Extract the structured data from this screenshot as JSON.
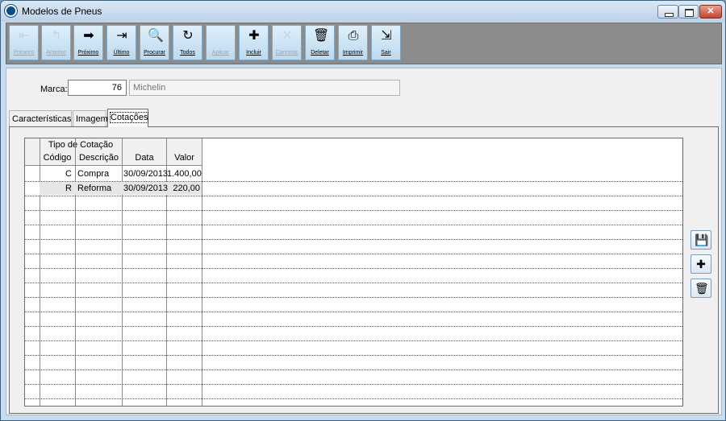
{
  "window": {
    "title": "Modelos de Pneus",
    "close_glyph": "✕"
  },
  "toolbar": {
    "buttons": [
      {
        "label": "Primeiro",
        "icon": "first-record-icon",
        "glyph": "⇤",
        "enabled": false
      },
      {
        "label": "Anterior",
        "icon": "previous-record-icon",
        "glyph": "↰",
        "enabled": false
      },
      {
        "label": "Próximo",
        "icon": "next-record-icon",
        "glyph": "➡",
        "enabled": true
      },
      {
        "label": "Último",
        "icon": "last-record-icon",
        "glyph": "⇥",
        "enabled": true
      },
      {
        "label": "Procurar",
        "icon": "search-icon",
        "glyph": "🔍",
        "enabled": true
      },
      {
        "label": "Todos",
        "icon": "refresh-all-icon",
        "glyph": "↻",
        "enabled": true
      },
      {
        "label": "Aplicar",
        "icon": "apply-icon",
        "glyph": "",
        "enabled": false
      },
      {
        "label": "Incluir",
        "icon": "new-record-icon",
        "glyph": "✚",
        "enabled": true
      },
      {
        "label": "Cancelar",
        "icon": "cancel-icon",
        "glyph": "✕",
        "enabled": false
      },
      {
        "label": "Deletar",
        "icon": "trash-icon",
        "glyph": "🗑",
        "enabled": true
      },
      {
        "label": "Imprimir",
        "icon": "printer-icon",
        "glyph": "⎙",
        "enabled": true
      },
      {
        "label": "Sair",
        "icon": "exit-icon",
        "glyph": "⇲",
        "enabled": true
      }
    ]
  },
  "marca": {
    "label": "Marca:",
    "code": "76",
    "name": "Michelin"
  },
  "tabs": [
    "Características",
    "Imagem",
    "Cotações"
  ],
  "grid": {
    "group_header": "Tipo de Cotação",
    "columns": [
      "Código",
      "Descrição",
      "Data",
      "Valor"
    ],
    "rows": [
      {
        "codigo": "C",
        "descricao": "Compra",
        "data": "30/09/2013",
        "valor": "1.400,00"
      },
      {
        "codigo": "R",
        "descricao": "Reforma",
        "data": "30/09/2013",
        "valor": "220,00"
      }
    ]
  },
  "side_buttons": [
    {
      "icon": "save-icon",
      "glyph": "💾"
    },
    {
      "icon": "new-record-icon",
      "glyph": "✚"
    },
    {
      "icon": "trash-icon",
      "glyph": "🗑"
    }
  ],
  "colors": {
    "toolbar_bg": "#8c8c8c",
    "accent": "#0a4b8a",
    "close_button": "#c2442c"
  }
}
